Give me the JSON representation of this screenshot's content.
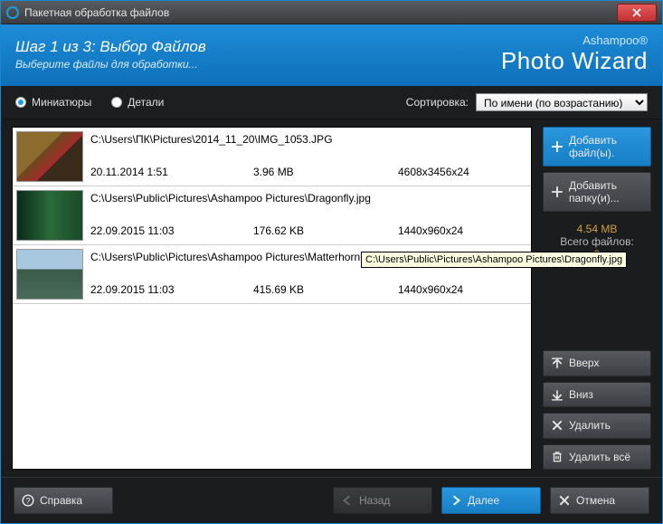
{
  "titlebar": {
    "title": "Пакетная обработка файлов"
  },
  "header": {
    "step": "Шаг 1 из 3: Выбор Файлов",
    "subtitle": "Выберите файлы для обработки...",
    "brand_top": "Ashampoo®",
    "brand_main": "Photo Wizard"
  },
  "toolbar": {
    "view_mode": "thumbnails",
    "thumbnails_label": "Миниатюры",
    "details_label": "Детали",
    "sort_label": "Сортировка:",
    "sort_value": "По имени (по возрастанию)"
  },
  "files": [
    {
      "path": "C:\\Users\\ПК\\Pictures\\2014_11_20\\IMG_1053.JPG",
      "date": "20.11.2014 1:51",
      "size": "3.96 MB",
      "dims": "4608x3456x24"
    },
    {
      "path": "C:\\Users\\Public\\Pictures\\Ashampoo Pictures\\Dragonfly.jpg",
      "date": "22.09.2015 11:03",
      "size": "176.62 KB",
      "dims": "1440x960x24"
    },
    {
      "path": "C:\\Users\\Public\\Pictures\\Ashampoo Pictures\\Matterhorn.jpg",
      "date": "22.09.2015 11:03",
      "size": "415.69 KB",
      "dims": "1440x960x24"
    }
  ],
  "tooltip": "C:\\Users\\Public\\Pictures\\Ashampoo Pictures\\Dragonfly.jpg",
  "side": {
    "add_files": "Добавить файл(ы).",
    "add_folder": "Добавить папку(и)...",
    "stats_size": "4.54 MB",
    "stats_label": "Всего файлов:",
    "stats_count": "3",
    "up": "Вверх",
    "down": "Вниз",
    "delete": "Удалить",
    "delete_all": "Удалить всё"
  },
  "footer": {
    "help": "Справка",
    "back": "Назад",
    "next": "Далее",
    "cancel": "Отмена"
  },
  "chart_data": null
}
